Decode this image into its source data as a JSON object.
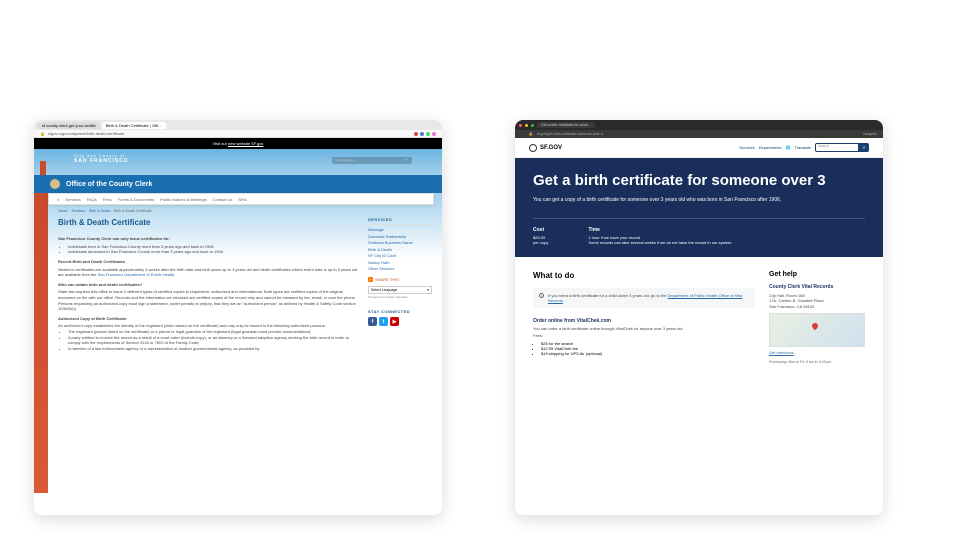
{
  "left": {
    "tabs": [
      "sf county clerk get your certific",
      "Birth & Death Certificate | Offi…"
    ],
    "url": "sfgov.org/countyclerk/birth-death-certificate",
    "ext_colors": [
      "#d94a4a",
      "#4a7dd9",
      "#4ad96a",
      "#e879d9"
    ],
    "top_banner_pre": "Visit our ",
    "top_banner_link": "new website SF.gov",
    "sf_label_top": "City and County of",
    "sf_label": "SAN FRANCISCO",
    "looking_for": "I'm looking for…",
    "dept": "Office of the County Clerk",
    "nav": [
      "Services",
      "FAQs",
      "Fees",
      "Forms & Documents",
      "Public Notices & Meetings",
      "Contact Us",
      "SRA"
    ],
    "crumbs": [
      "Home",
      "Services",
      "Birth & Death",
      "Birth & Death Certificate"
    ],
    "h1": "Birth & Death Certificate",
    "intro": "San Francisco County Clerk can only issue certificates for:",
    "intro_items": [
      "Individuals born in San Francisco County more than 3 years ago and back to 1906",
      "Individuals deceased in San Francisco County more than 3 years ago and back to 1906"
    ],
    "recent_h": "Recent Birth and Death Certificates",
    "recent_p": "Newborn certificates are available approximately 4 weeks after the birth date and birth years up to 3 years old and death certificates where event date is up to 3 years old are available from the ",
    "recent_link": "San Francisco Department of Public Health",
    "recent_tail": ".",
    "who_h": "Who can obtain birth and death certificates?",
    "who_p": "State law requires this office to issue 2 different types of certified copies to requesters: authorized and informational. Both types are certified copies of the original document on file with our office. Records and the information we released are certified copies of the record only and cannot be released by fax, email, or over the phone. Persons requesting an authorized copy must sign a statement, under penalty of perjury, that they are an \"authorized person\" as defined by Health & Safety Code section 103526(c).",
    "auth_h": "Authorized Copy of Birth Certificate:",
    "auth_p": "An authorized copy establishes the identity of the registrant (child named on the certificate) and may only be issued to the following authorized persons:",
    "auth_items": [
      "The registrant (person listed on the certificate) or a parent or legal guardian of the registrant (legal guardian must provide documentation);",
      "A party entitled to receive the record as a result of a court order (include copy), or an attorney or a licensed adoption agency seeking the birth record in order to comply with the requirements of Section 3140 or 7603 of the Family Code;",
      "A member of a law enforcement agency or a representative of another governmental agency, as provided by"
    ],
    "sidebar": {
      "services_h": "SERVICES",
      "links": [
        "Marriage",
        "Domestic Partnership",
        "Fictitious Business Name",
        "Birth & Death",
        "SF City ID Card",
        "Notary Oath",
        "Other Services"
      ],
      "share": "SHARE THIS",
      "lang": "Select Language",
      "lang_arrow": "▾",
      "powered": "Powered by Google Translate",
      "stay": "STAY CONNECTED",
      "social": {
        "fb": "f",
        "tw": "t",
        "yt": "▶"
      }
    }
  },
  "right": {
    "mac_dots": [
      "#ff5f56",
      "#ffbd2e",
      "#27c93f"
    ],
    "tab": "Get a birth certificate for some…",
    "url": "sf.gov/get-birth-certificate-someone-over-3",
    "incog": "Incognito",
    "logo": "SF.GOV",
    "hdr_links": [
      "Services",
      "Departments"
    ],
    "translate": "Translate",
    "search_ph": "Search",
    "hero_title": "Get a birth certificate for someone over 3",
    "hero_sub": "You can get a copy of a birth certificate for someone over 3 years old who was born in San Francisco after 1906.",
    "cost_h": "Cost",
    "cost_v": "$25.00",
    "cost_per": "per copy",
    "time_h": "Time",
    "time_v": "1 hour if we have your record.",
    "time_note": "Some records can take several weeks if we do not have the record in our system.",
    "whattodo": "What to do",
    "info_note_pre": "If you need a birth certificate for a child under 3 years old, go to the ",
    "info_note_link": "Department of Public Health Office of Vital Records",
    "info_note_post": ".",
    "step1_h": "Order online from VitalChek.com",
    "step1_p": "You can order a birth certificate online through VitalChek for anyone over 3 years old.",
    "fees_h": "Fees:",
    "fees": [
      "$25 for the search",
      "$12.95 VitalChek fee",
      "$19 shipping for UPS Air (optional)"
    ],
    "gethelp": "Get help",
    "gh_sub": "County Clerk Vital Records",
    "addr": [
      "City Hall, Room 168",
      "1 Dr. Carlton B. Goodlett Place",
      "San Francisco, CA 94102"
    ],
    "dir_link": "Get directions",
    "hours": "Processing: Mon to Fri, 8 am to 3:45 pm"
  }
}
